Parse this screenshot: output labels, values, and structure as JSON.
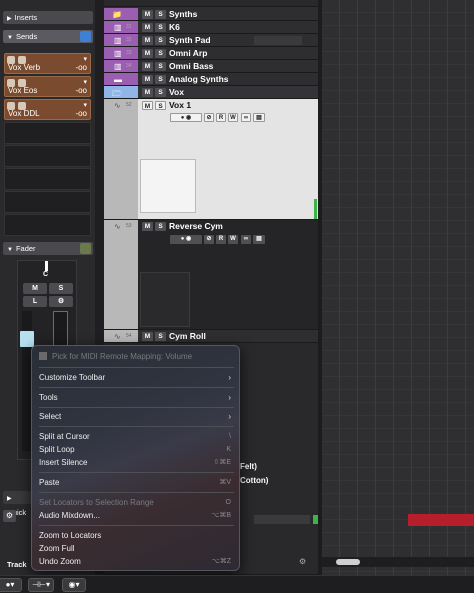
{
  "inspector": {
    "inserts_label": "Inserts",
    "sends_label": "Sends",
    "sends": [
      {
        "name": "Vox Verb",
        "value": "-oo"
      },
      {
        "name": "Vox Eos",
        "value": "-oo"
      },
      {
        "name": "Vox DDL",
        "value": "-oo"
      }
    ],
    "fader_label": "Fader",
    "channel_letter": "C",
    "mute": "M",
    "solo": "S",
    "listen": "L",
    "quick_label": "Quick",
    "track_tab": "Track"
  },
  "tracks": [
    {
      "num": "",
      "name": "Synths",
      "color": "#9a5fb0",
      "type": "folder"
    },
    {
      "num": "31",
      "name": "K6",
      "color": "#9a5fb0",
      "type": "instrument"
    },
    {
      "num": "32",
      "name": "Synth Pad",
      "color": "#9a5fb0",
      "type": "instrument"
    },
    {
      "num": "33",
      "name": "Omni Arp",
      "color": "#9a5fb0",
      "type": "instrument"
    },
    {
      "num": "34",
      "name": "Omni Bass",
      "color": "#9a5fb0",
      "type": "instrument"
    },
    {
      "num": "",
      "name": "Analog Synths",
      "color": "#9a5fb0",
      "type": "folder"
    },
    {
      "num": "",
      "name": "Vox",
      "color": "#8fb6e6",
      "type": "folder"
    },
    {
      "num": "52",
      "name": "Vox 1",
      "color": "#b8b8b8",
      "type": "audio"
    },
    {
      "num": "53",
      "name": "Reverse Cym",
      "color": "#b8b8b8",
      "type": "audio"
    },
    {
      "num": "54",
      "name": "Cym Roll",
      "color": "#b8b8b8",
      "type": "audio"
    }
  ],
  "track_buttons": {
    "mute": "M",
    "solo": "S",
    "read": "R",
    "write": "W"
  },
  "partial_labels": [
    "Felt)",
    "Cotton)"
  ],
  "context_menu": {
    "header": "Pick for MIDI Remote Mapping: Volume",
    "items": [
      {
        "label": "Customize Toolbar",
        "submenu": true,
        "shortcut": "",
        "disabled": false
      },
      {
        "label": "Tools",
        "submenu": true,
        "shortcut": "",
        "disabled": false
      },
      {
        "label": "Select",
        "submenu": true,
        "shortcut": "",
        "disabled": false
      },
      {
        "label": "Split at Cursor",
        "submenu": false,
        "shortcut": "\\",
        "disabled": false
      },
      {
        "label": "Split Loop",
        "submenu": false,
        "shortcut": "K",
        "disabled": false
      },
      {
        "label": "Insert Silence",
        "submenu": false,
        "shortcut": "⇧⌘E",
        "disabled": false
      },
      {
        "label": "Paste",
        "submenu": false,
        "shortcut": "⌘V",
        "disabled": false
      },
      {
        "label": "Set Locators to Selection Range",
        "submenu": false,
        "shortcut": "O",
        "disabled": true
      },
      {
        "label": "Audio Mixdown...",
        "submenu": false,
        "shortcut": "⌥⌘B",
        "disabled": false
      },
      {
        "label": "Zoom to Locators",
        "submenu": false,
        "shortcut": "",
        "disabled": false
      },
      {
        "label": "Zoom Full",
        "submenu": false,
        "shortcut": "",
        "disabled": false
      },
      {
        "label": "Undo Zoom",
        "submenu": false,
        "shortcut": "⌥⌘Z",
        "disabled": false
      }
    ]
  },
  "colors": {
    "accent_purple": "#9a5fb0",
    "vox_blue": "#8fb6e6",
    "send_brown": "#7a4b2e",
    "region_red": "#b51e2a",
    "meter_green": "#3bb44a"
  }
}
